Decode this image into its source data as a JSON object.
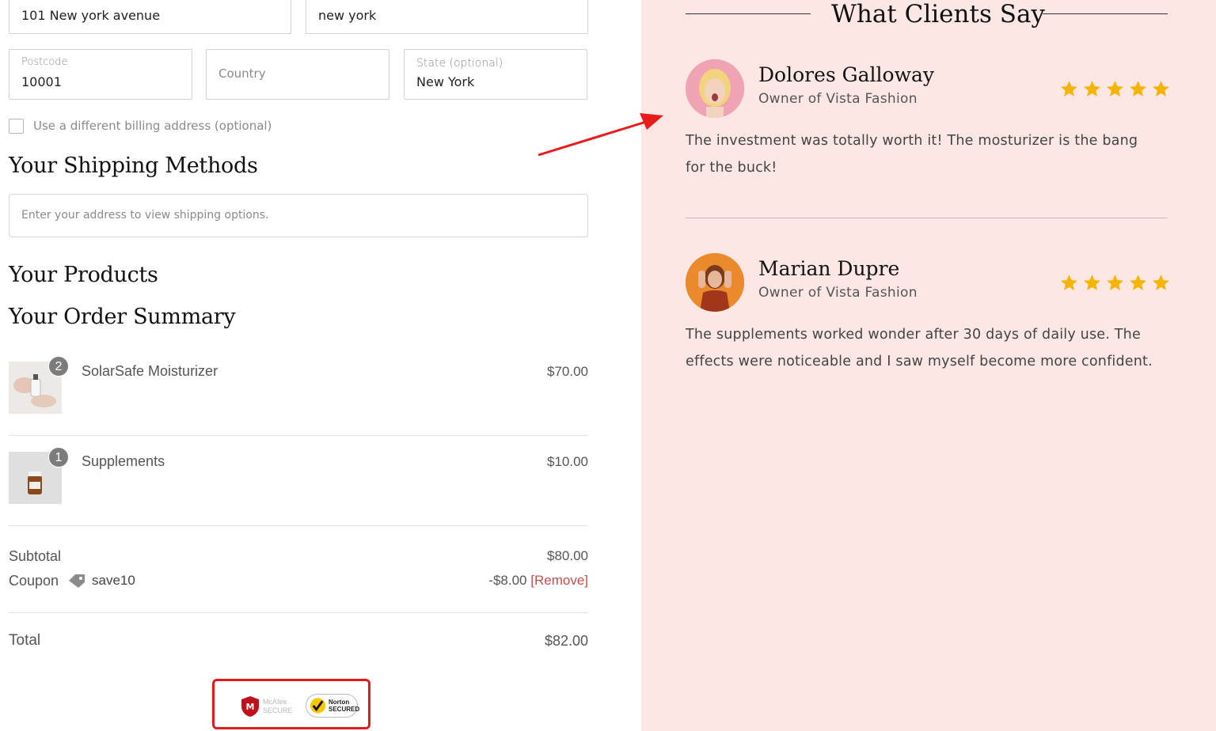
{
  "address": {
    "street_value": "101 New york avenue",
    "city_value": "new york",
    "postcode_label": "Postcode",
    "postcode_value": "10001",
    "country_placeholder": "Country",
    "state_label": "State (optional)",
    "state_value": "New York",
    "billing_checkbox_label": "Use a different billing address (optional)"
  },
  "shipping": {
    "heading": "Your Shipping Methods",
    "placeholder": "Enter your address to view shipping options."
  },
  "products": {
    "heading": "Your Products"
  },
  "summary": {
    "heading": "Your Order Summary",
    "items": [
      {
        "name": "SolarSafe Moisturizer",
        "price": "$70.00",
        "qty": "2"
      },
      {
        "name": "Supplements",
        "price": "$10.00",
        "qty": "1"
      }
    ],
    "subtotal_label": "Subtotal",
    "subtotal_value": "$80.00",
    "coupon_label": "Coupon",
    "coupon_code": "save10",
    "coupon_value": "-$8.00",
    "coupon_remove": "[Remove]",
    "total_label": "Total",
    "total_value": "$82.00"
  },
  "trust_badges": {
    "mcafee": "McAfee SECURE",
    "norton": "Norton SECURED"
  },
  "testimonials": {
    "title": "What Clients Say",
    "items": [
      {
        "name": "Dolores Galloway",
        "role": "Owner of Vista Fashion",
        "rating": 5,
        "quote": "The investment was totally worth it! The mosturizer is the bang for the buck!"
      },
      {
        "name": "Marian Dupre",
        "role": "Owner of Vista Fashion",
        "rating": 5,
        "quote": "The supplements worked wonder after 30 days of daily use. The effects were noticeable and I saw myself become more confident."
      }
    ]
  },
  "colors": {
    "right_bg": "#fde7e5",
    "star": "#f5b400",
    "highlight": "#e01b1b",
    "remove_link": "#c0504d"
  }
}
